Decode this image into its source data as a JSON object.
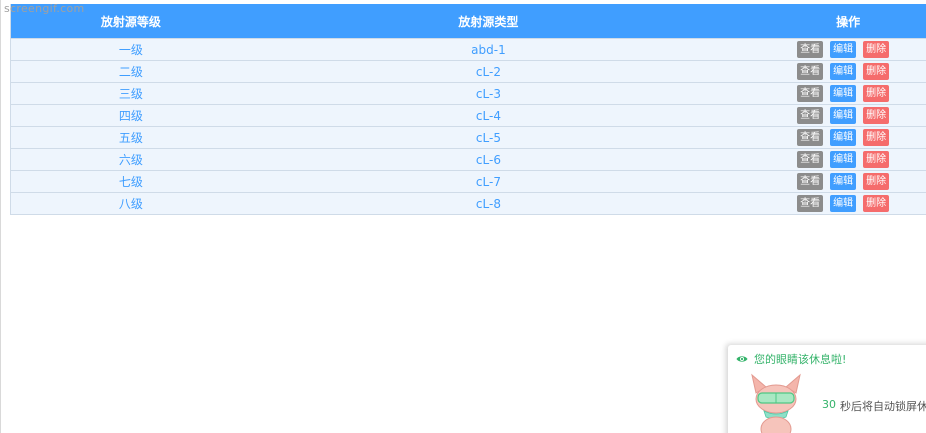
{
  "watermark": "screengif.com",
  "table": {
    "headers": {
      "level": "放射源等级",
      "type": "放射源类型",
      "ops": "操作"
    },
    "rows": [
      {
        "level": "一级",
        "type": "abd-1"
      },
      {
        "level": "二级",
        "type": "cL-2"
      },
      {
        "level": "三级",
        "type": "cL-3"
      },
      {
        "level": "四级",
        "type": "cL-4"
      },
      {
        "level": "五级",
        "type": "cL-5"
      },
      {
        "level": "六级",
        "type": "cL-6"
      },
      {
        "level": "七级",
        "type": "cL-7"
      },
      {
        "level": "八级",
        "type": "cL-8"
      }
    ],
    "actions": {
      "view": "查看",
      "edit": "编辑",
      "delete": "删除"
    }
  },
  "popup": {
    "title": "您的眼睛该休息啦!",
    "countdown": "30",
    "message": "秒后将自动锁屏休"
  },
  "colors": {
    "header_bg": "#409eff",
    "row_bg": "#eef5fd",
    "view_btn": "#8c8c8c",
    "edit_btn": "#409eff",
    "delete_btn": "#f56c6c",
    "popup_accent": "#34b36a"
  }
}
